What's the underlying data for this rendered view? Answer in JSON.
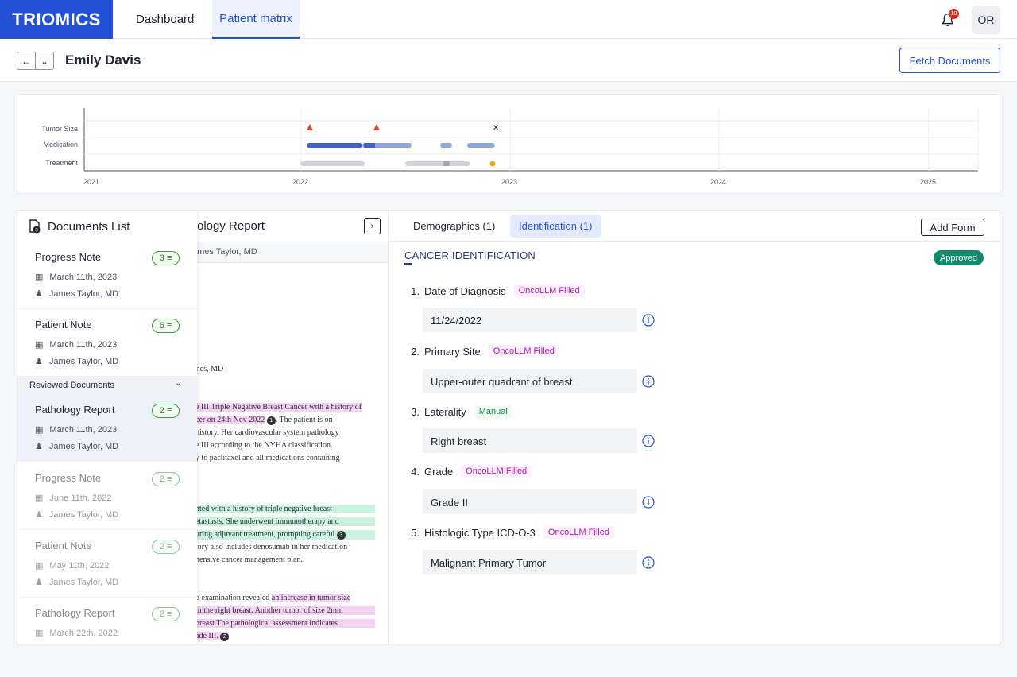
{
  "brand": {
    "logo": "TRIOMICS",
    "color": "#2450d8"
  },
  "nav": {
    "tabs": [
      {
        "label": "Dashboard"
      },
      {
        "label": "Patient matrix"
      }
    ]
  },
  "notifications": {
    "count": "10"
  },
  "user": {
    "initials": "OR"
  },
  "patient": {
    "name": "Emily Davis",
    "fetch_label": "Fetch Documents"
  },
  "timeline": {
    "rows": [
      "Tumor Size",
      "Medication",
      "Treatment"
    ],
    "years": [
      "2021",
      "2022",
      "2023",
      "2024",
      "2025"
    ]
  },
  "doc_list": {
    "title": "Documents List",
    "icon_badge": "3",
    "reviewed_label": "Reviewed Documents",
    "items": [
      {
        "title": "Progress Note",
        "count": "3",
        "date": "March 11th, 2023",
        "author": "James Taylor, MD"
      },
      {
        "title": "Patient Note",
        "count": "6",
        "date": "March 11th, 2023",
        "author": "James Taylor, MD"
      },
      {
        "title": "Pathology Report",
        "count": "2",
        "date": "March 11th, 2023",
        "author": "James Taylor, MD"
      },
      {
        "title": "Progress Note",
        "count": "2",
        "date": "June 11th, 2022",
        "author": "James Taylor, MD"
      },
      {
        "title": "Patient Note",
        "count": "2",
        "date": "May 11th, 2022",
        "author": "James Taylor, MD"
      },
      {
        "title": "Pathology Report",
        "count": "2",
        "date": "March 22th, 2022",
        "author": ""
      }
    ]
  },
  "doc_view": {
    "title": "Pathology Report",
    "title_visible": "ology Report",
    "author": "ames Taylor, MD",
    "signature": "mes, MD",
    "lines": [
      "e III Triple Negative Breast Cancer with a history of",
      "cer on 24th Nov 2022",
      ". The patient is on",
      "history. Her cardiovascular system pathology",
      "e III according to the NYHA classification.",
      "y to paclitaxel and all medications containing",
      "nted with a history of triple negative breast",
      "etastasis. She underwent immunotherapy and",
      "uring adjuvant treatment, prompting careful",
      "tory also includes denosumab in her medication",
      "hensive cancer management plan.",
      "o examination revealed ",
      "an increase in tumor size",
      "in the right breast. Another tumor of size 2mm",
      "breast.The pathological assessment indicates",
      "ade III."
    ],
    "markers": [
      "1",
      "3",
      "2"
    ]
  },
  "form": {
    "tabs": [
      {
        "label": "Demographics (1)"
      },
      {
        "label": "Identification (1)"
      }
    ],
    "add_form_label": "Add Form",
    "section_title": "CANCER IDENTIFICATION",
    "status": "Approved",
    "questions": [
      {
        "num": "1.",
        "label": "Date of Diagnosis",
        "tag": "OncoLLM Filled",
        "value": "11/24/2022"
      },
      {
        "num": "2.",
        "label": "Primary Site",
        "tag": "OncoLLM Filled",
        "value": "Upper-outer quadrant of breast"
      },
      {
        "num": "3.",
        "label": "Laterality",
        "tag": "Manual",
        "value": "Right breast"
      },
      {
        "num": "4.",
        "label": "Grade",
        "tag": "OncoLLM Filled",
        "value": "Grade II"
      },
      {
        "num": "5.",
        "label": "Histologic Type ICD-O-3",
        "tag": "OncoLLM Filled",
        "value": "Malignant Primary Tumor"
      }
    ]
  }
}
